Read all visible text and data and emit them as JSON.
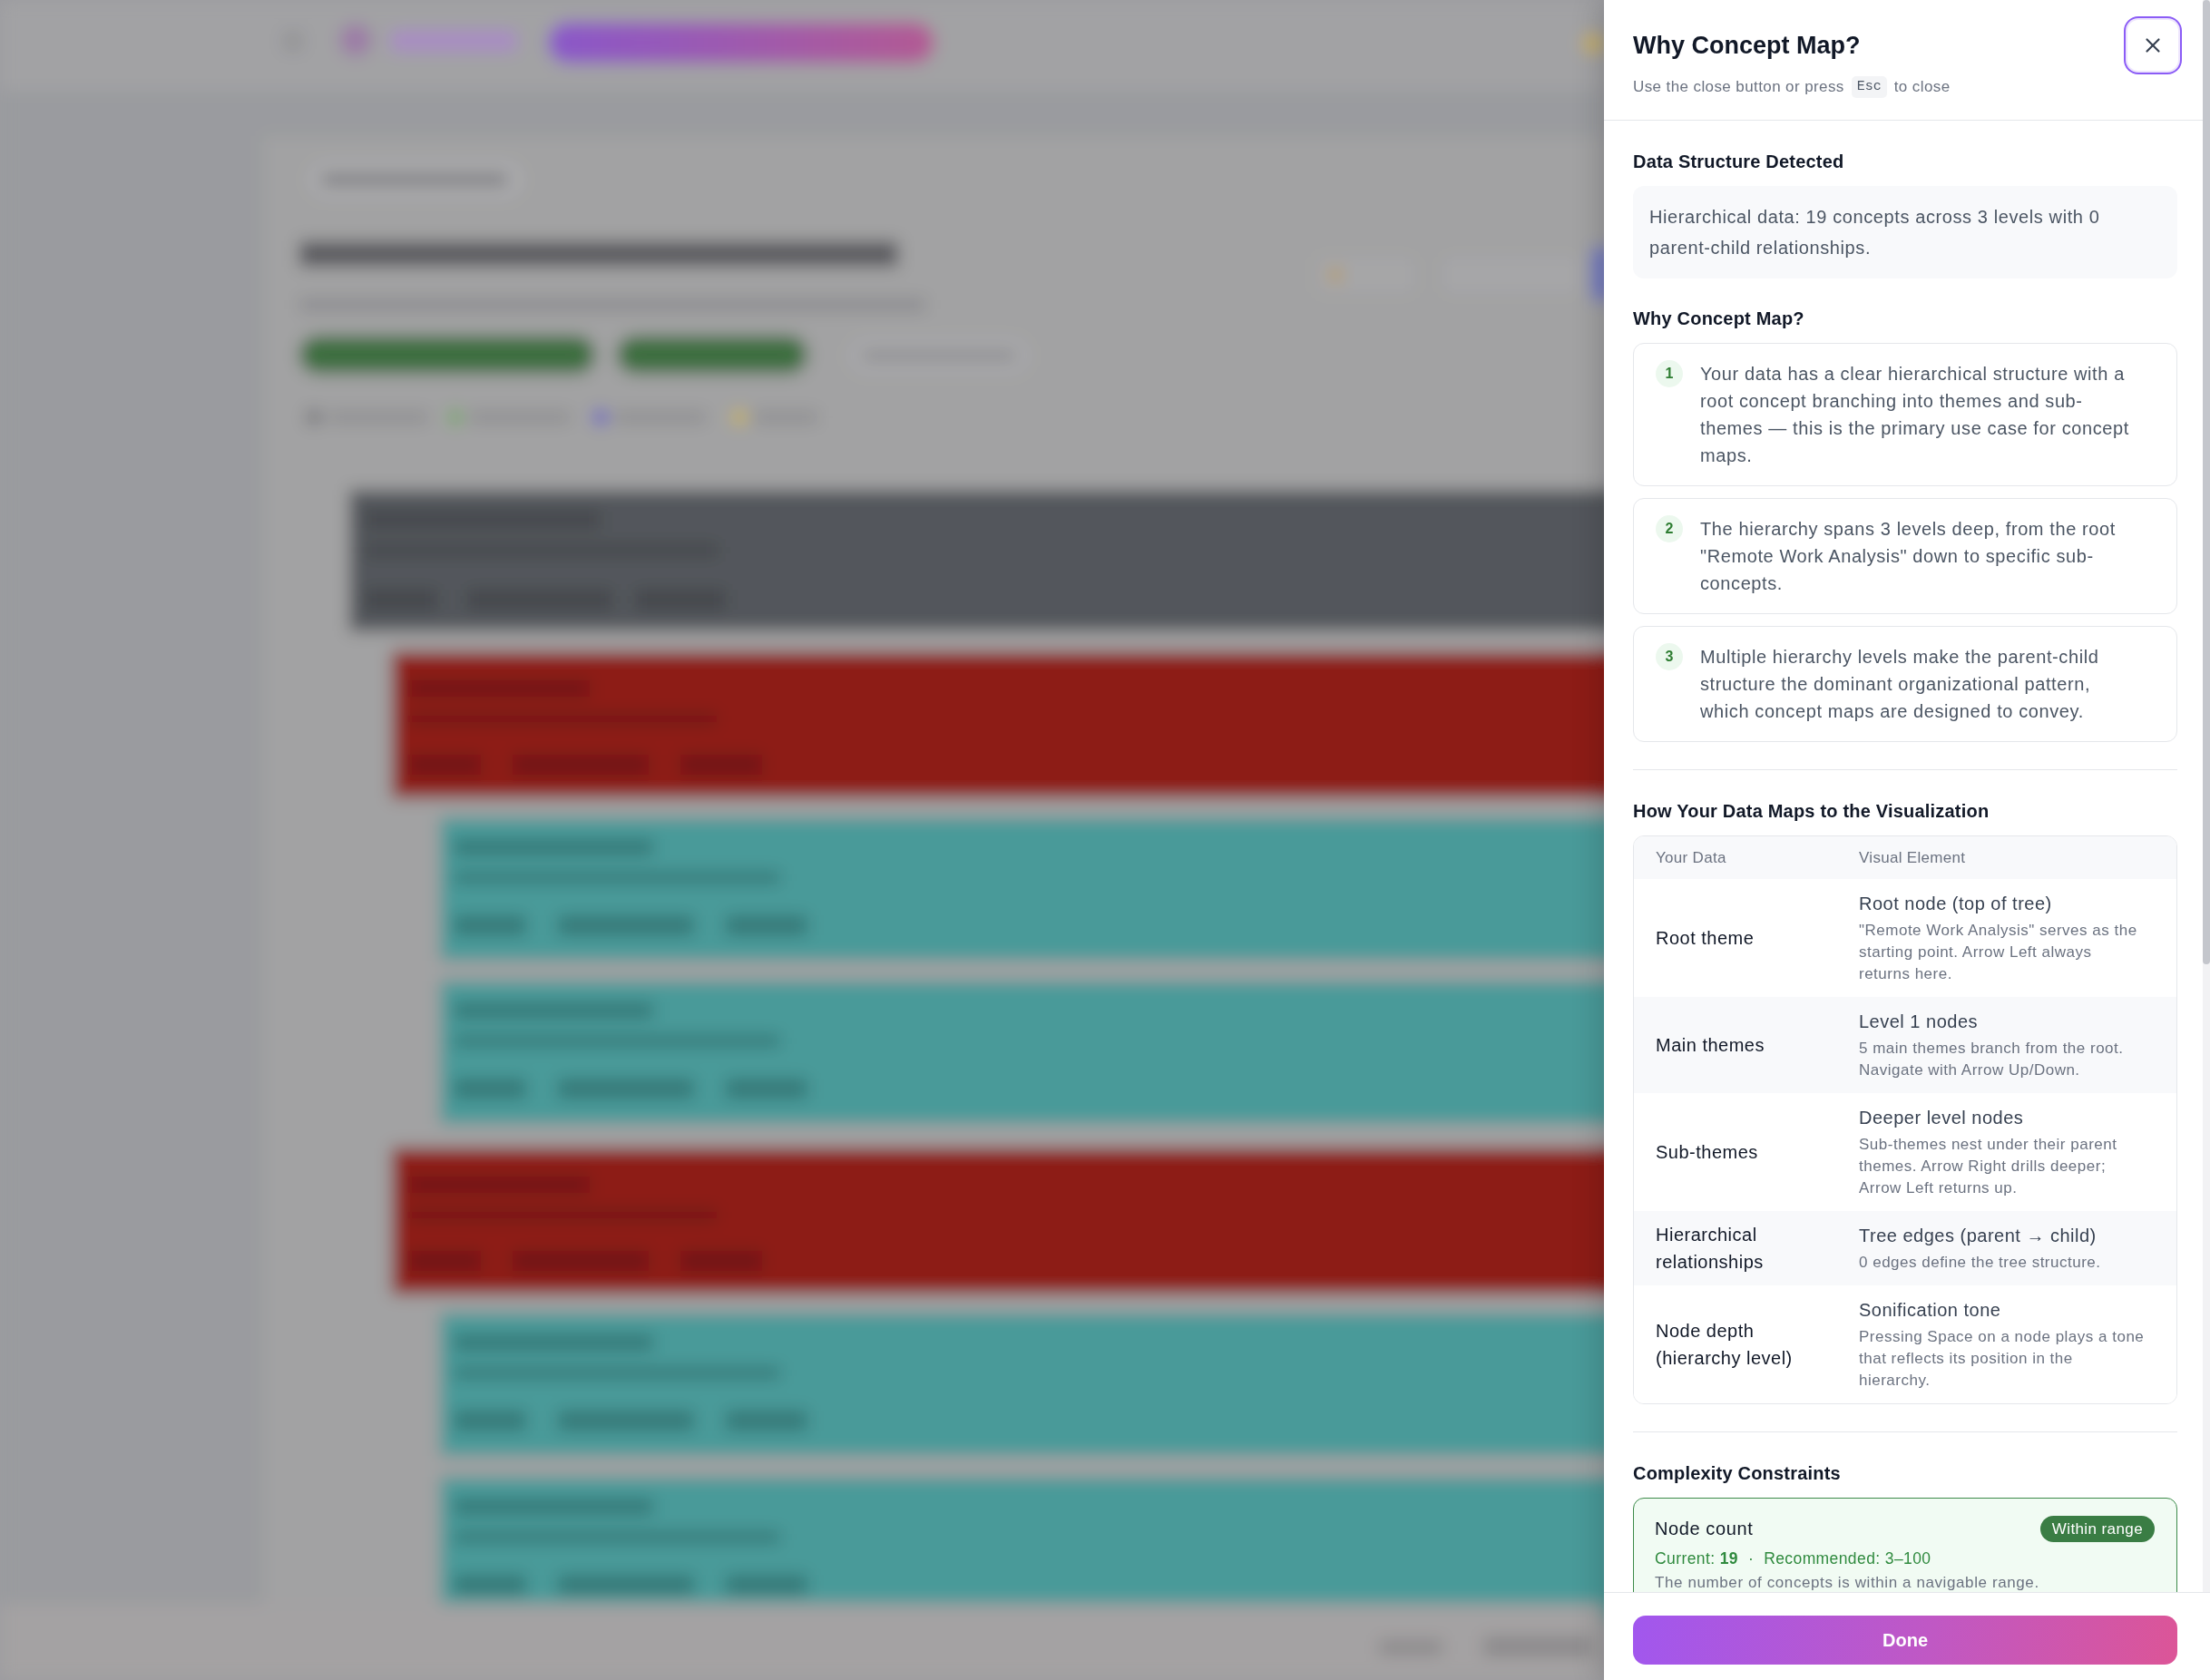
{
  "backdrop": {
    "blurred": true
  },
  "dialog": {
    "title": "Why Concept Map?",
    "close_button": {
      "focused": true
    },
    "hint": {
      "before": "Use the close button or press",
      "key": "Esc",
      "after": "to close"
    },
    "data_structure": {
      "heading": "Data Structure Detected",
      "summary": "Hierarchical data: 19 concepts across 3 levels with 0 parent-child relationships."
    },
    "reasons": {
      "heading": "Why Concept Map?",
      "items": [
        {
          "number": "1",
          "text": "Your data has a clear hierarchical structure with a root concept branching into themes and sub-themes — this is the primary use case for concept maps."
        },
        {
          "number": "2",
          "text": "The hierarchy spans 3 levels deep, from the root \"Remote Work Analysis\" down to specific sub-concepts."
        },
        {
          "number": "3",
          "text": "Multiple hierarchy levels make the parent-child structure the dominant organizational pattern, which concept maps are designed to convey."
        }
      ]
    },
    "mapping": {
      "heading": "How Your Data Maps to the Visualization",
      "columns": [
        "Your Data",
        "Visual Element"
      ],
      "rows": [
        {
          "data": "Root theme",
          "element": "Root node (top of tree)",
          "description": "\"Remote Work Analysis\" serves as the starting point. Arrow Left always returns here."
        },
        {
          "data": "Main themes",
          "element": "Level 1 nodes",
          "description": "5 main themes branch from the root. Navigate with Arrow Up/Down."
        },
        {
          "data": "Sub-themes",
          "element": "Deeper level nodes",
          "description": "Sub-themes nest under their parent themes. Arrow Right drills deeper; Arrow Left returns up."
        },
        {
          "data": "Hierarchical relationships",
          "element": "Tree edges (parent → child)",
          "description": "0 edges define the tree structure."
        },
        {
          "data": "Node depth (hierarchy level)",
          "element": "Sonification tone",
          "description": "Pressing Space on a node plays a tone that reflects its position in the hierarchy."
        }
      ]
    },
    "constraints": {
      "heading": "Complexity Constraints",
      "items": [
        {
          "name": "Node count",
          "status": {
            "label": "Within range",
            "kind": "ok"
          },
          "current": "Current: **19**",
          "separator": "·",
          "recommended": "Recommended: 3–100",
          "note": "The number of concepts is within a navigable range."
        }
      ]
    }
  },
  "footer": {
    "done_button": "Done"
  }
}
